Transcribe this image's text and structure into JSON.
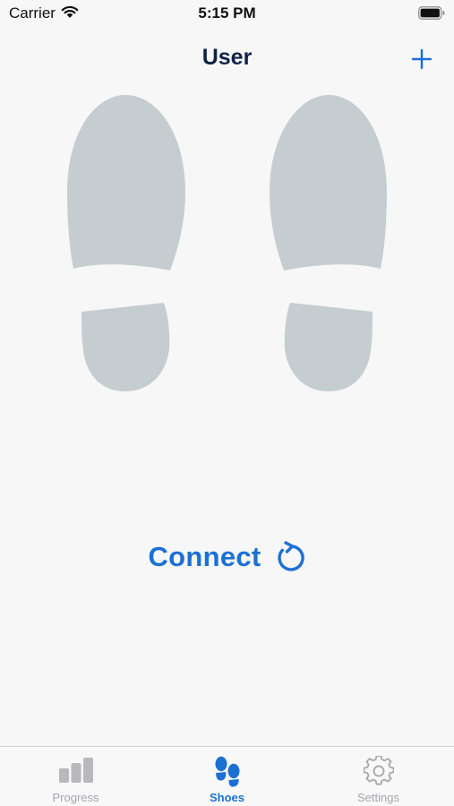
{
  "status_bar": {
    "carrier": "Carrier",
    "time": "5:15 PM"
  },
  "nav": {
    "title": "User",
    "add_icon": "plus-icon"
  },
  "main": {
    "connect_label": "Connect",
    "connect_icon": "refresh-icon"
  },
  "tab_bar": {
    "items": [
      {
        "label": "Progress",
        "icon": "bar-chart-icon",
        "active": false
      },
      {
        "label": "Shoes",
        "icon": "footprints-icon",
        "active": true
      },
      {
        "label": "Settings",
        "icon": "gear-icon",
        "active": false
      }
    ]
  },
  "colors": {
    "accent": "#1c70d3",
    "title": "#0d2245",
    "footprint": "#c6cdd0",
    "inactive": "#a6a6ab",
    "background": "#f7f7f7"
  }
}
